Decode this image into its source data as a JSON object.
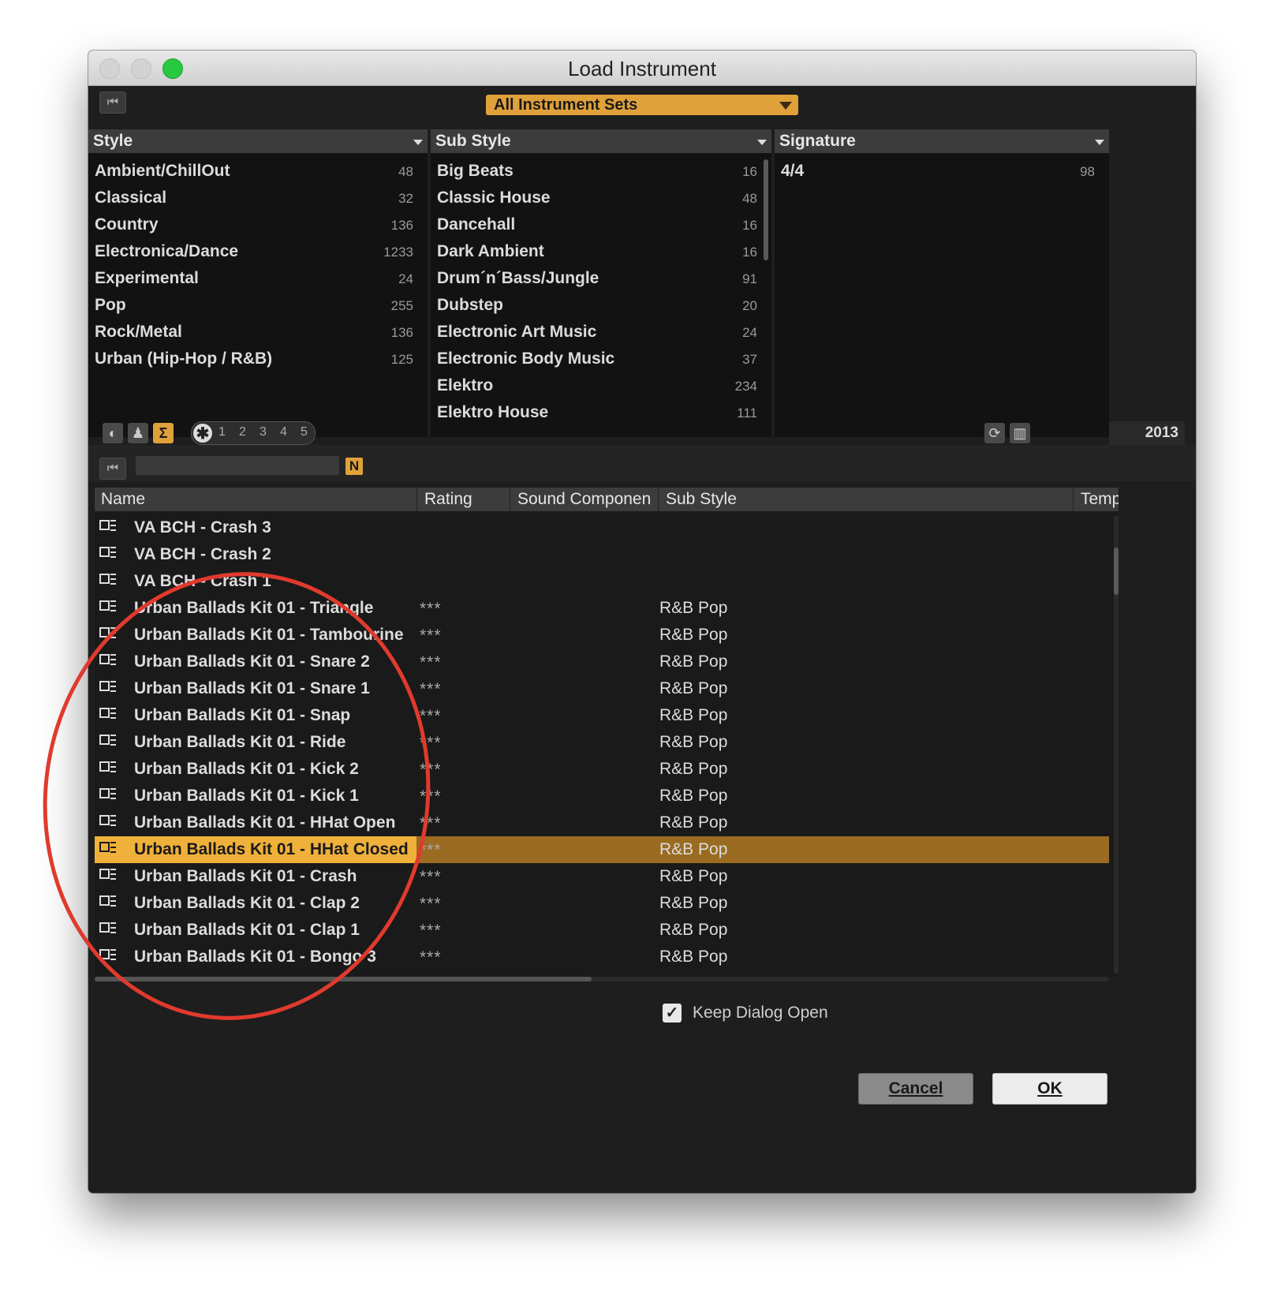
{
  "window": {
    "title": "Load Instrument"
  },
  "instrument_set": "All Instrument Sets",
  "filters": {
    "style": {
      "header": "Style",
      "items": [
        {
          "label": "Ambient/ChillOut",
          "count": "48"
        },
        {
          "label": "Classical",
          "count": "32"
        },
        {
          "label": "Country",
          "count": "136"
        },
        {
          "label": "Electronica/Dance",
          "count": "1233"
        },
        {
          "label": "Experimental",
          "count": "24"
        },
        {
          "label": "Pop",
          "count": "255"
        },
        {
          "label": "Rock/Metal",
          "count": "136"
        },
        {
          "label": "Urban (Hip-Hop / R&B)",
          "count": "125"
        }
      ]
    },
    "substyle": {
      "header": "Sub Style",
      "items": [
        {
          "label": "Big Beats",
          "count": "16"
        },
        {
          "label": "Classic House",
          "count": "48"
        },
        {
          "label": "Dancehall",
          "count": "16"
        },
        {
          "label": "Dark Ambient",
          "count": "16"
        },
        {
          "label": "Drum´n´Bass/Jungle",
          "count": "91"
        },
        {
          "label": "Dubstep",
          "count": "20"
        },
        {
          "label": "Electronic Art Music",
          "count": "24"
        },
        {
          "label": "Electronic Body Music",
          "count": "37"
        },
        {
          "label": "Elektro",
          "count": "234"
        },
        {
          "label": "Elektro House",
          "count": "111"
        }
      ]
    },
    "signature": {
      "header": "Signature",
      "items": [
        {
          "label": "4/4",
          "count": "98"
        }
      ]
    }
  },
  "toolbar": {
    "rating_filter": [
      "1",
      "2",
      "3",
      "4",
      "5"
    ],
    "result_count": "2013",
    "new_badge": "N"
  },
  "list": {
    "columns": [
      "Name",
      "Rating",
      "Sound Componen",
      "Sub Style",
      "Temp"
    ],
    "rows": [
      {
        "name": "VA BCH - Crash 3",
        "rating": "",
        "substyle": ""
      },
      {
        "name": "VA BCH - Crash 2",
        "rating": "",
        "substyle": ""
      },
      {
        "name": "VA BCH - Crash 1",
        "rating": "",
        "substyle": ""
      },
      {
        "name": "Urban Ballads Kit 01 - Triangle",
        "rating": "***",
        "substyle": "R&B Pop"
      },
      {
        "name": "Urban Ballads Kit 01 - Tambourine",
        "rating": "***",
        "substyle": "R&B Pop"
      },
      {
        "name": "Urban Ballads Kit 01 - Snare 2",
        "rating": "***",
        "substyle": "R&B Pop"
      },
      {
        "name": "Urban Ballads Kit 01 - Snare 1",
        "rating": "***",
        "substyle": "R&B Pop"
      },
      {
        "name": "Urban Ballads Kit 01 - Snap",
        "rating": "***",
        "substyle": "R&B Pop"
      },
      {
        "name": "Urban Ballads Kit 01 - Ride",
        "rating": "***",
        "substyle": "R&B Pop"
      },
      {
        "name": "Urban Ballads Kit 01 - Kick 2",
        "rating": "***",
        "substyle": "R&B Pop"
      },
      {
        "name": "Urban Ballads Kit 01 - Kick 1",
        "rating": "***",
        "substyle": "R&B Pop"
      },
      {
        "name": "Urban Ballads Kit 01 - HHat Open",
        "rating": "***",
        "substyle": "R&B Pop"
      },
      {
        "name": "Urban Ballads Kit 01 - HHat Closed",
        "rating": "***",
        "substyle": "R&B Pop",
        "selected": true
      },
      {
        "name": "Urban Ballads Kit 01 - Crash",
        "rating": "***",
        "substyle": "R&B Pop"
      },
      {
        "name": "Urban Ballads Kit 01 - Clap 2",
        "rating": "***",
        "substyle": "R&B Pop"
      },
      {
        "name": "Urban Ballads Kit 01 - Clap 1",
        "rating": "***",
        "substyle": "R&B Pop"
      },
      {
        "name": "Urban Ballads Kit 01 - Bongo 3",
        "rating": "***",
        "substyle": "R&B Pop"
      }
    ]
  },
  "keep_dialog_open": {
    "label": "Keep Dialog Open",
    "checked": true
  },
  "buttons": {
    "cancel": "Cancel",
    "ok": "OK"
  },
  "colors": {
    "accent": "#e0a13a",
    "selected_row": "#9a6b21",
    "annotation": "#e03a2e"
  }
}
